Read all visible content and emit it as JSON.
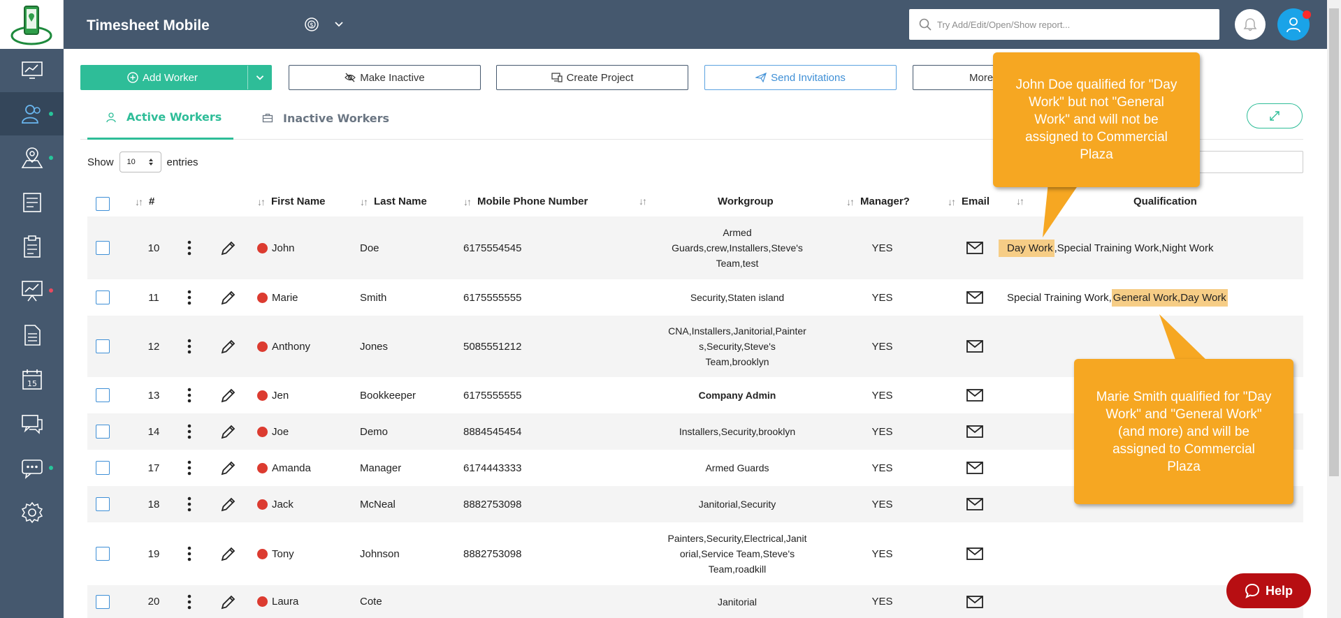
{
  "app": {
    "title": "Timesheet Mobile"
  },
  "search": {
    "placeholder": "Try Add/Edit/Open/Show report..."
  },
  "sidebar": {
    "items": [
      {
        "name": "dashboard",
        "icon": "monitor-chart-icon",
        "dot": null,
        "active": false
      },
      {
        "name": "workers",
        "icon": "users-icon",
        "dot": "green",
        "active": true
      },
      {
        "name": "map",
        "icon": "map-pin-icon",
        "dot": "green",
        "active": false
      },
      {
        "name": "timesheet",
        "icon": "timesheet-icon",
        "dot": null,
        "active": false
      },
      {
        "name": "clipboard",
        "icon": "clipboard-icon",
        "dot": null,
        "active": false
      },
      {
        "name": "reports",
        "icon": "presentation-chart-icon",
        "dot": "red",
        "active": false
      },
      {
        "name": "documents",
        "icon": "document-icon",
        "dot": null,
        "active": false
      },
      {
        "name": "calendar",
        "icon": "calendar-icon",
        "dot": null,
        "active": false
      },
      {
        "name": "messages",
        "icon": "chat-icon",
        "dot": null,
        "active": false
      },
      {
        "name": "comments",
        "icon": "comment-dots-icon",
        "dot": "green",
        "active": false
      },
      {
        "name": "settings",
        "icon": "gear-icon",
        "dot": null,
        "active": false
      }
    ]
  },
  "toolbar": {
    "add_worker": "Add Worker",
    "make_inactive": "Make Inactive",
    "create_project": "Create Project",
    "send_invitations": "Send Invitations",
    "more": "More"
  },
  "tabs": {
    "active": "Active Workers",
    "inactive": "Inactive Workers"
  },
  "entries": {
    "show": "Show",
    "count": "10",
    "entries": "entries"
  },
  "table": {
    "headers": {
      "num": "#",
      "first_name": "First Name",
      "last_name": "Last Name",
      "phone": "Mobile Phone Number",
      "workgroup": "Workgroup",
      "manager": "Manager?",
      "email": "Email",
      "qualification": "Qualification"
    },
    "rows": [
      {
        "num": "10",
        "first": "John",
        "last": "Doe",
        "phone": "6175554545",
        "workgroup": [
          "Armed",
          "Guards,crew,Installers,Steve's",
          "Team,test"
        ],
        "manager": "YES",
        "qual_pre": "",
        "qual_hl": "Day Work",
        "qual_post": ",Special Training Work,Night Work"
      },
      {
        "num": "11",
        "first": "Marie",
        "last": "Smith",
        "phone": "6175555555",
        "workgroup": [
          "Security,Staten island"
        ],
        "manager": "YES",
        "qual_pre": "Special Training Work,",
        "qual_hl": "General Work,Day Work",
        "qual_post": ""
      },
      {
        "num": "12",
        "first": "Anthony",
        "last": "Jones",
        "phone": "5085551212",
        "workgroup": [
          "CNA,Installers,Janitorial,Painter",
          "s,Security,Steve's",
          "Team,brooklyn"
        ],
        "manager": "YES",
        "qual_pre": "",
        "qual_hl": "",
        "qual_post": ""
      },
      {
        "num": "13",
        "first": "Jen",
        "last": "Bookkeeper",
        "phone": "6175555555",
        "workgroup": [
          "Company Admin"
        ],
        "manager": "YES",
        "qual_pre": "",
        "qual_hl": "",
        "qual_post": ""
      },
      {
        "num": "14",
        "first": "Joe",
        "last": "Demo",
        "phone": "8884545454",
        "workgroup": [
          "Installers,Security,brooklyn"
        ],
        "manager": "YES",
        "qual_pre": "",
        "qual_hl": "",
        "qual_post": ""
      },
      {
        "num": "17",
        "first": "Amanda",
        "last": "Manager",
        "phone": "6174443333",
        "workgroup": [
          "Armed Guards"
        ],
        "manager": "YES",
        "qual_pre": "",
        "qual_hl": "",
        "qual_post": ""
      },
      {
        "num": "18",
        "first": "Jack",
        "last": "McNeal",
        "phone": "8882753098",
        "workgroup": [
          "Janitorial,Security"
        ],
        "manager": "YES",
        "qual_pre": "",
        "qual_hl": "",
        "qual_post": ""
      },
      {
        "num": "19",
        "first": "Tony",
        "last": "Johnson",
        "phone": "8882753098",
        "workgroup": [
          "Painters,Security,Electrical,Janit",
          "orial,Service Team,Steve's",
          "Team,roadkill"
        ],
        "manager": "YES",
        "qual_pre": "",
        "qual_hl": "",
        "qual_post": ""
      },
      {
        "num": "20",
        "first": "Laura",
        "last": "Cote",
        "phone": "",
        "workgroup": [
          "Janitorial"
        ],
        "manager": "YES",
        "qual_pre": "",
        "qual_hl": "",
        "qual_post": ""
      }
    ]
  },
  "callouts": {
    "john": "John Doe qualified for \"Day Work\" but not \"General Work\" and will not be assigned to Commercial Plaza",
    "marie": "Marie Smith qualified for \"Day Work\" and \"General Work\" (and more) and will be assigned to Commercial Plaza"
  },
  "help": {
    "label": "Help"
  },
  "colors": {
    "sidebar": "#45586e",
    "accent": "#2ebd98",
    "callout": "#f6a722",
    "highlight": "#f6cd86",
    "help": "#b70e12"
  }
}
